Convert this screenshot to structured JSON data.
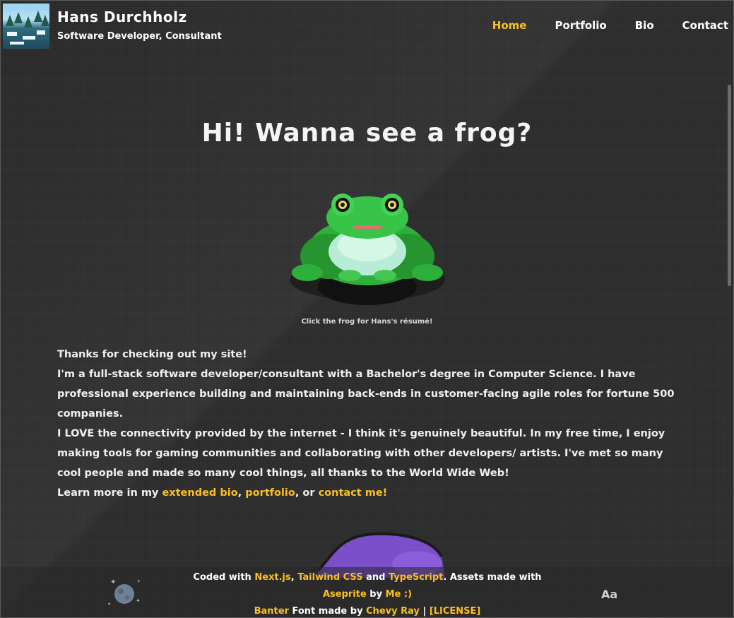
{
  "header": {
    "title": "Hans Durchholz",
    "subtitle": "Software Developer, Consultant",
    "logo_icon": "pixel-landscape-icon"
  },
  "nav": {
    "items": [
      {
        "label": "Home",
        "active": true
      },
      {
        "label": "Portfolio",
        "active": false
      },
      {
        "label": "Bio",
        "active": false
      },
      {
        "label": "Contact",
        "active": false
      }
    ]
  },
  "main": {
    "headline": "Hi! Wanna see a frog?",
    "frog_icon": "pixel-frog-icon",
    "caption": "Click the frog for Hans's résumé!",
    "bio": {
      "line1": "Thanks for checking out my site!",
      "para2": "I'm a full-stack software developer/consultant with a Bachelor's degree in Computer Science. I have professional experience building and maintaining back-ends in customer-facing agile roles for fortune 500 companies.",
      "para3": "I LOVE the connectivity provided by the internet - I think it's genuinely beautiful. In my free time, I enjoy making tools for gaming communities and collaborating with other developers/ artists. I've met so many cool people and made so many cool things, all thanks to the World Wide Web!",
      "learn_prefix": "Learn more in my ",
      "link_bio": "extended bio",
      "sep1": ", ",
      "link_portfolio": "portfolio",
      "sep2": ", or ",
      "link_contact": "contact me!"
    }
  },
  "footer": {
    "coded_with": "Coded with ",
    "nextjs": "Next.js",
    "comma": ", ",
    "tailwind": "Tailwind CSS",
    "and": " and ",
    "typescript": "TypeScript",
    "assets_made_with": ". Assets made with ",
    "aseprite": "Aseprite",
    "by": " by ",
    "me": "Me :)",
    "banter": "Banter",
    "font_made_by": " Font made by ",
    "chevy": "Chevy Ray",
    "pipe": " | ",
    "license": "[LICENSE]",
    "font_toggle": "Aa",
    "theme_icon": "moon-stars-icon"
  },
  "colors": {
    "accent": "#fbbf24",
    "background": "#303030",
    "text": "#f2f2f2"
  }
}
